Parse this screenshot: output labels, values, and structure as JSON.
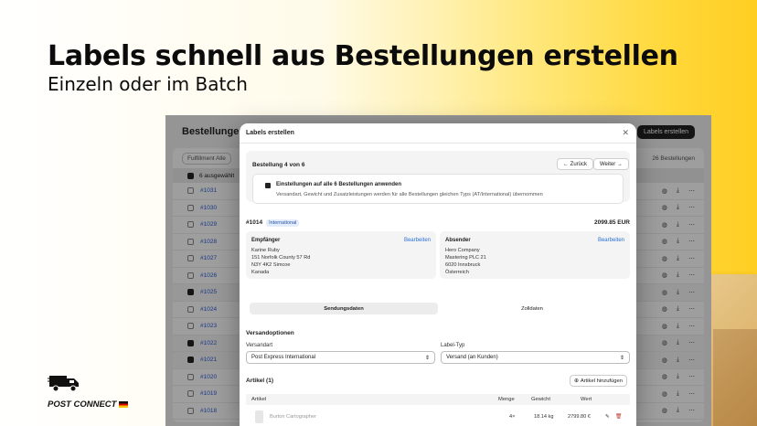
{
  "hero": {
    "title": "Labels schnell aus Bestellungen erstellen",
    "subtitle": "Einzeln oder im Batch"
  },
  "logo": {
    "text": "POST CONNECT",
    "icon": "truck-icon"
  },
  "app": {
    "title": "Bestellungen",
    "create_button": "Labels erstellen",
    "filter_label": "Fulfillment Alle",
    "count_label": "26 Bestellungen",
    "selected_label": "6 ausgewählt",
    "orders": [
      {
        "id": "#1031",
        "selected": false
      },
      {
        "id": "#1030",
        "selected": false
      },
      {
        "id": "#1029",
        "selected": false
      },
      {
        "id": "#1028",
        "selected": false
      },
      {
        "id": "#1027",
        "selected": false
      },
      {
        "id": "#1026",
        "selected": false
      },
      {
        "id": "#1025",
        "selected": true
      },
      {
        "id": "#1024",
        "selected": false
      },
      {
        "id": "#1023",
        "selected": false
      },
      {
        "id": "#1022",
        "selected": true
      },
      {
        "id": "#1021",
        "selected": true
      },
      {
        "id": "#1020",
        "selected": false
      },
      {
        "id": "#1019",
        "selected": false
      },
      {
        "id": "#1018",
        "selected": false
      }
    ]
  },
  "modal": {
    "title": "Labels erstellen",
    "nav": {
      "label": "Bestellung 4 von 6",
      "back": "← Zurück",
      "next": "Weiter →"
    },
    "apply": {
      "label": "Einstellungen auf alle 6 Bestellungen anwenden",
      "desc": "Versandart, Gewicht und Zusatzleistungen werden für alle Bestellungen gleichen Typs (AT/International) übernommen"
    },
    "order": {
      "id": "#1014",
      "badge": "International",
      "total": "2099.85 EUR"
    },
    "recipient": {
      "heading": "Empfänger",
      "edit": "Bearbeiten",
      "name": "Karine Ruby",
      "line1": "151 Norfolk County 57 Rd",
      "line2": "N3Y 4K2 Simcoe",
      "line3": "Kanada"
    },
    "sender": {
      "heading": "Absender",
      "edit": "Bearbeiten",
      "name": "Hero Company",
      "line1": "Mastering PLC 21",
      "line2": "6020 Innsbruck",
      "line3": "Österreich"
    },
    "tabs": [
      "Sendungsdaten",
      "Zolldaten"
    ],
    "shipping": {
      "heading": "Versandoptionen",
      "method_label": "Versandart",
      "method_value": "Post Express International",
      "type_label": "Label-Typ",
      "type_value": "Versand (an Kunden)"
    },
    "articles": {
      "heading": "Artikel (1)",
      "add_button": "Artikel hinzufügen",
      "columns": {
        "article": "Artikel",
        "qty": "Menge",
        "weight": "Gewicht",
        "value": "Wert"
      },
      "rows": [
        {
          "name": "Burton Cartographer",
          "qty": "4×",
          "weight": "18.14 kg",
          "value": "2799.80 €"
        }
      ]
    }
  },
  "colors": {
    "accent": "#ffd83a",
    "link": "#2a6fd6",
    "dark": "#222222"
  }
}
